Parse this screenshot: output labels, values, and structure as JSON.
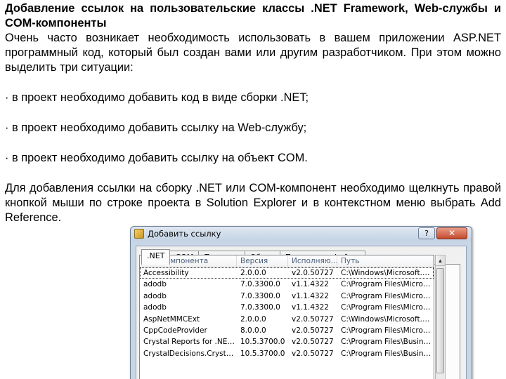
{
  "document": {
    "heading": "Добавление ссылок на пользовательские классы .NET Framework, Web-службы и COM-компоненты",
    "intro": "Очень часто возникает необходимость использовать в вашем приложении ASP.NET программный код, который был создан вами или другим разработчиком. При этом можно выделить три ситуации:",
    "bullets": [
      "· в проект необходимо добавить код в виде сборки .NET;",
      "· в проект необходимо добавить ссылку на Web-службу;",
      "· в проект необходимо добавить ссылку на объект COM."
    ],
    "closing": "Для добавления ссылки на сборку .NET или COM-компонент необходимо щелкнуть правой кнопкой мыши по строке проекта в Solution Explorer и в контекстном меню выбрать Add Reference."
  },
  "dialog": {
    "title": "Добавить ссылку",
    "help_label": "?",
    "close_label": "✕",
    "tabs": [
      ".NET",
      "COM",
      "Проекты",
      "Обзор",
      "Последние файлы"
    ],
    "active_tab": ".NET",
    "columns": [
      "Имя компонента",
      "Версия",
      "Исполняю...",
      "Путь"
    ],
    "rows": [
      [
        "Accessibility",
        "2.0.0.0",
        "v2.0.50727",
        "C:\\Windows\\Microsoft.N..."
      ],
      [
        "adodb",
        "7.0.3300.0",
        "v1.1.4322",
        "C:\\Program Files\\Microso..."
      ],
      [
        "adodb",
        "7.0.3300.0",
        "v1.1.4322",
        "C:\\Program Files\\Microso..."
      ],
      [
        "adodb",
        "7.0.3300.0",
        "v1.1.4322",
        "C:\\Program Files\\Microso..."
      ],
      [
        "AspNetMMCExt",
        "2.0.0.0",
        "v2.0.50727",
        "C:\\Windows\\Microsoft.N..."
      ],
      [
        "CppCodeProvider",
        "8.0.0.0",
        "v2.0.50727",
        "C:\\Program Files\\Microso..."
      ],
      [
        "Crystal Reports for .NET Fr...",
        "10.5.3700.0",
        "v2.0.50727",
        "C:\\Program Files\\Business..."
      ],
      [
        "CrystalDecisions.CrystalRe...",
        "10.5.3700.0",
        "v2.0.50727",
        "C:\\Program Files\\Business..."
      ]
    ],
    "selected_row": 0,
    "scroll_up_glyph": "▲"
  },
  "colors": {
    "dialog_frame": "#c9d6e6",
    "close_button": "#c34a2e",
    "header_text": "#4c607a"
  }
}
